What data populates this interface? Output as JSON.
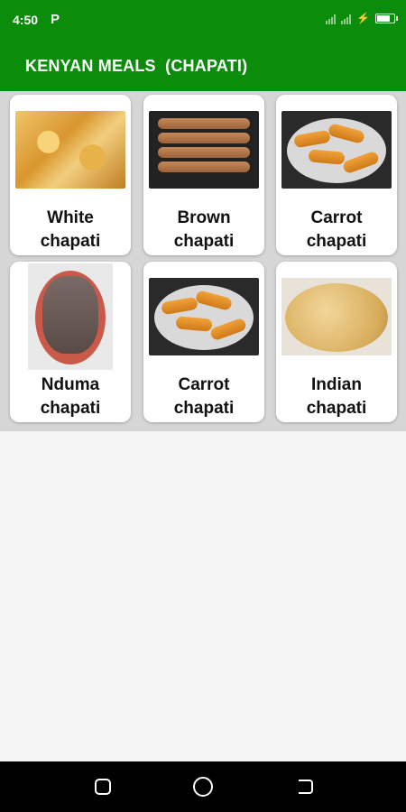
{
  "status_bar": {
    "time": "4:50",
    "app_icon": "P"
  },
  "app_bar": {
    "title": "KENYAN MEALS  (CHAPATI)"
  },
  "colors": {
    "primary": "#0b8c0b",
    "background": "#f5f5f5"
  },
  "meals": [
    {
      "line1": "White",
      "line2": "chapati",
      "image": "white-chapati-photo"
    },
    {
      "line1": "Brown",
      "line2": "chapati",
      "image": "brown-chapati-photo"
    },
    {
      "line1": "Carrot",
      "line2": "chapati",
      "image": "carrot-chapati-photo"
    },
    {
      "line1": "Nduma",
      "line2": "chapati",
      "image": "nduma-chapati-photo"
    },
    {
      "line1": "Carrot",
      "line2": "chapati",
      "image": "carrot-chapati-photo"
    },
    {
      "line1": "Indian",
      "line2": "chapati",
      "image": "indian-chapati-photo"
    }
  ]
}
